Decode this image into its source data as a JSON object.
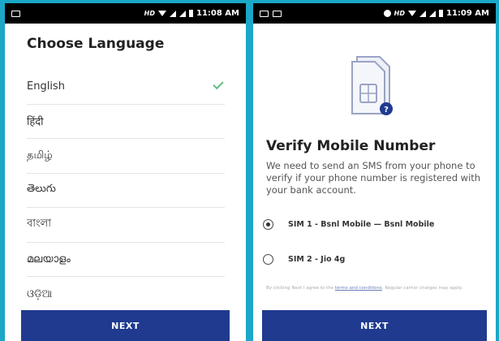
{
  "left": {
    "status": {
      "hd": "HD",
      "time": "11:08 AM"
    },
    "title": "Choose Language",
    "languages": [
      {
        "label": "English",
        "selected": true
      },
      {
        "label": "हिंदी",
        "selected": false
      },
      {
        "label": "தமிழ்",
        "selected": false
      },
      {
        "label": "తెలుగు",
        "selected": false
      },
      {
        "label": "বাংলা",
        "selected": false
      },
      {
        "label": "മലയാളം",
        "selected": false
      },
      {
        "label": "ଓଡ଼ିଆ",
        "selected": false
      }
    ],
    "next_label": "NEXT"
  },
  "right": {
    "status": {
      "hd": "HD",
      "time": "11:09 AM"
    },
    "title": "Verify Mobile Number",
    "description": "We need to send an SMS from your phone to verify if your phone number is registered with your bank account.",
    "sims": [
      {
        "label": "SIM 1 - Bsnl Mobile — Bsnl Mobile",
        "selected": true
      },
      {
        "label": "SIM 2 - Jio 4g",
        "selected": false
      }
    ],
    "fine_print_prefix": "By clicking Next I agree to the ",
    "fine_print_link": "terms and conditions",
    "fine_print_suffix": ". Regular carrier charges may apply.",
    "next_label": "NEXT"
  },
  "colors": {
    "background": "#1aa7c8",
    "button": "#1f3a8f",
    "check": "#5fbf7f",
    "sim_badge": "#1f3a8f"
  }
}
